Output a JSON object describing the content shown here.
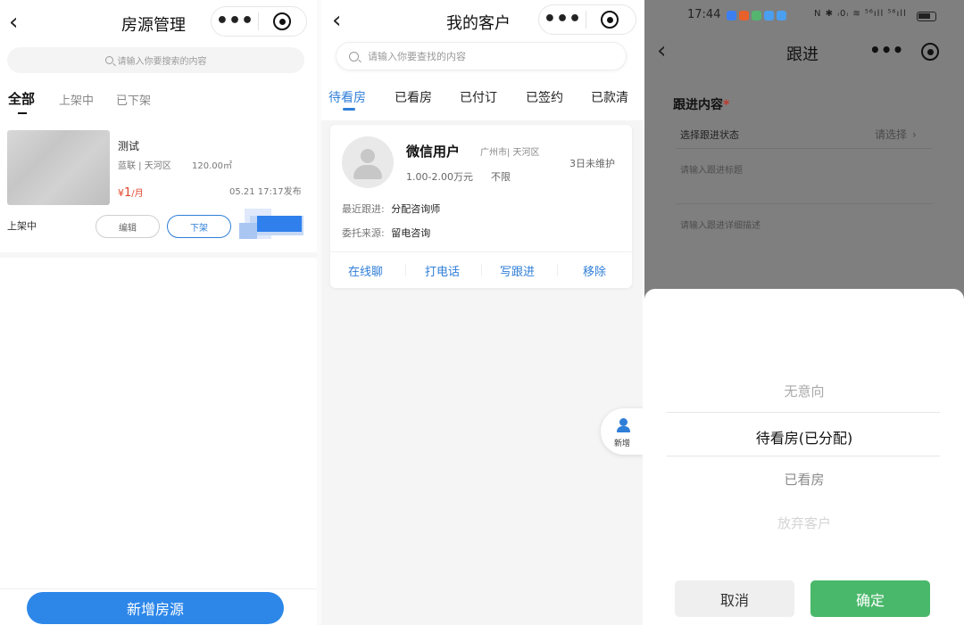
{
  "panel1": {
    "title": "房源管理",
    "search_placeholder": "请输入你要搜索的内容",
    "tabs": [
      {
        "label": "全部",
        "active": true
      },
      {
        "label": "上架中",
        "active": false
      },
      {
        "label": "已下架",
        "active": false
      }
    ],
    "listing": {
      "title": "测试",
      "location": "蓝联 | 天河区",
      "area": "120.00㎡",
      "price_symbol": "¥",
      "price_value": "1",
      "price_unit": "/月",
      "published": "05.21 17:17发布",
      "status": "上架中",
      "edit_label": "编辑",
      "offline_label": "下架"
    },
    "add_button_label": "新增房源"
  },
  "panel2": {
    "title": "我的客户",
    "search_placeholder": "请输入你要查找的内容",
    "tabs": [
      {
        "label": "待看房",
        "active": true
      },
      {
        "label": "已看房",
        "active": false
      },
      {
        "label": "已付订",
        "active": false
      },
      {
        "label": "已签约",
        "active": false
      },
      {
        "label": "已款清",
        "active": false
      }
    ],
    "customer": {
      "name": "微信用户",
      "location": "广州市| 天河区",
      "budget": "1.00-2.00万元",
      "limit": "不限",
      "maintenance": "3日未维护",
      "recent_follow_label": "最近跟进:",
      "recent_follow_value": "分配咨询师",
      "source_label": "委托来源:",
      "source_value": "留电咨询"
    },
    "actions": [
      "在线聊",
      "打电话",
      "写跟进",
      "移除"
    ],
    "fab_label": "新增"
  },
  "panel3": {
    "status_bar": {
      "time": "17:44",
      "icons_text": "N ✱ ᵢ0ᵢ ≋ ⁵⁶ıll ⁵⁶ıll"
    },
    "title": "跟进",
    "section_title": "跟进内容",
    "required_mark": "*",
    "status_label": "选择跟进状态",
    "status_value": "请选择",
    "title_placeholder": "请输入跟进标题",
    "desc_placeholder": "请输入跟进详细描述",
    "picker_options": [
      {
        "label": "无意向",
        "state": "faded"
      },
      {
        "label": "待看房(已分配)",
        "state": "selected"
      },
      {
        "label": "已看房",
        "state": "normal"
      },
      {
        "label": "放弃客户",
        "state": "disabled"
      }
    ],
    "cancel_label": "取消",
    "confirm_label": "确定"
  },
  "colors": {
    "accent_blue": "#2f7ed8",
    "price_red": "#e2452c",
    "confirm_green": "#4ab86a"
  }
}
